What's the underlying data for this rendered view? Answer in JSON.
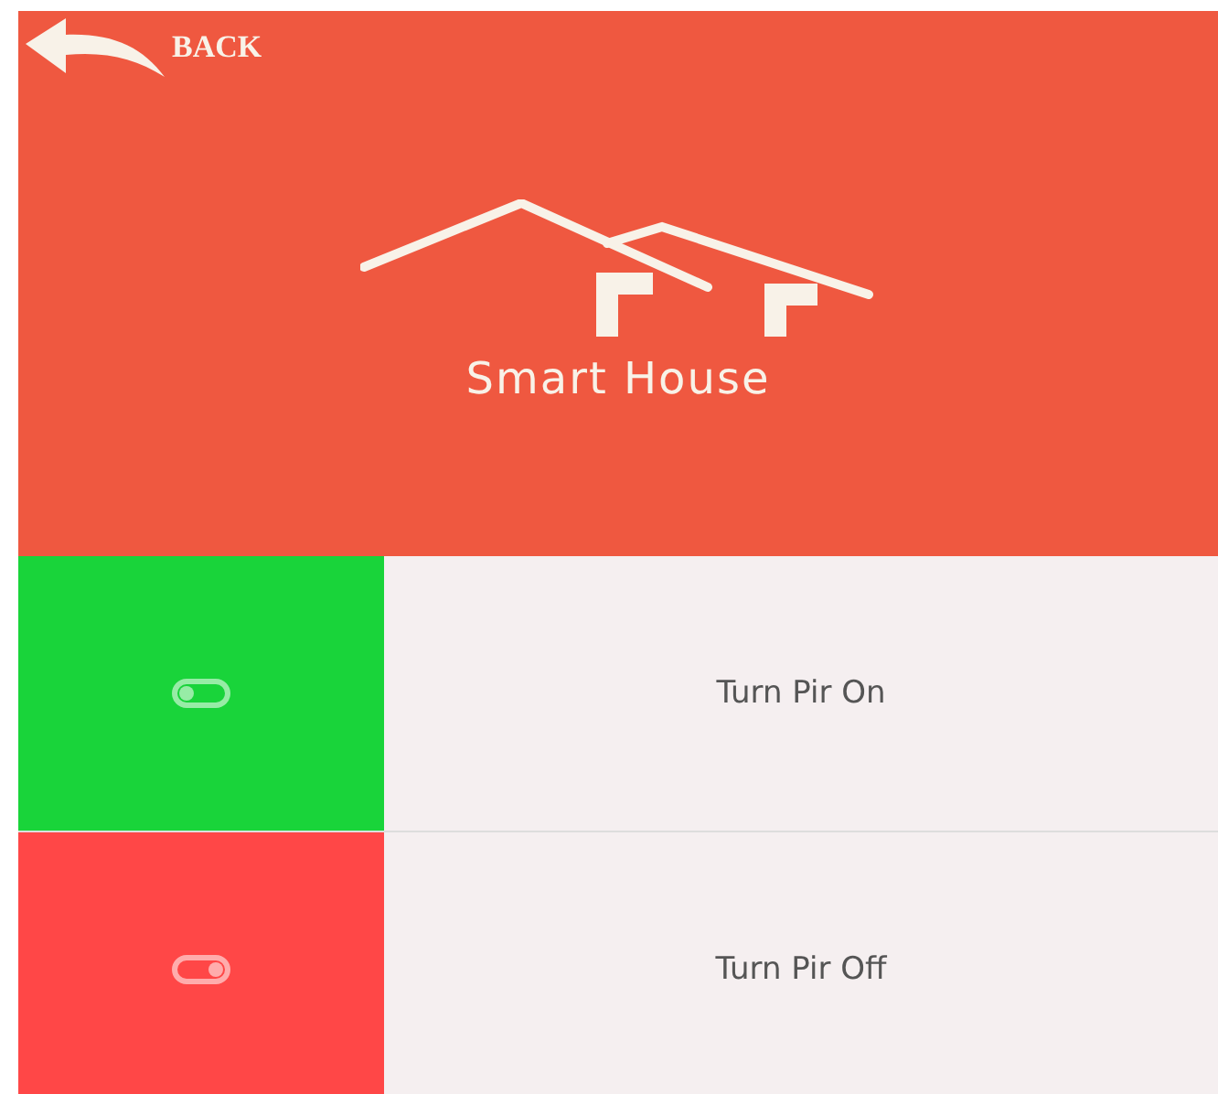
{
  "header": {
    "back_label": "BACK",
    "title": "Smart House"
  },
  "actions": [
    {
      "kind": "on",
      "label": "Turn Pir On",
      "color": "#19d43a"
    },
    {
      "kind": "off",
      "label": "Turn Pir Off",
      "color": "#ff4747"
    }
  ]
}
